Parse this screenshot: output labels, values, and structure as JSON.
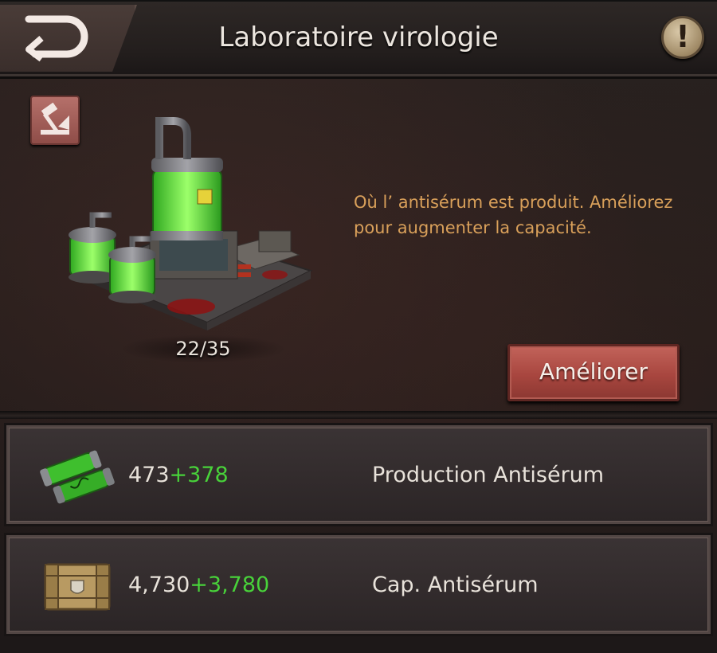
{
  "header": {
    "title": "Laboratoire virologie",
    "back_icon": "back-arrow-icon",
    "info_icon": "exclamation-icon",
    "info_symbol": "!"
  },
  "building": {
    "level": "22/35",
    "description": "Où l’ antisérum est produit. Améliorez pour augmenter la capacité.",
    "upgrade_label": "Améliorer",
    "tool_icon": "hammer-icon"
  },
  "stats": [
    {
      "icon": "antiserum-vials-icon",
      "value": "473",
      "bonus": "+378",
      "label": "Production Antisérum"
    },
    {
      "icon": "supply-crate-icon",
      "value": "4,730",
      "bonus": "+3,780",
      "label": "Cap. Antisérum"
    }
  ],
  "colors": {
    "accent_text": "#d9a05a",
    "bonus_green": "#48d23a",
    "button_red": "#a8463f"
  }
}
